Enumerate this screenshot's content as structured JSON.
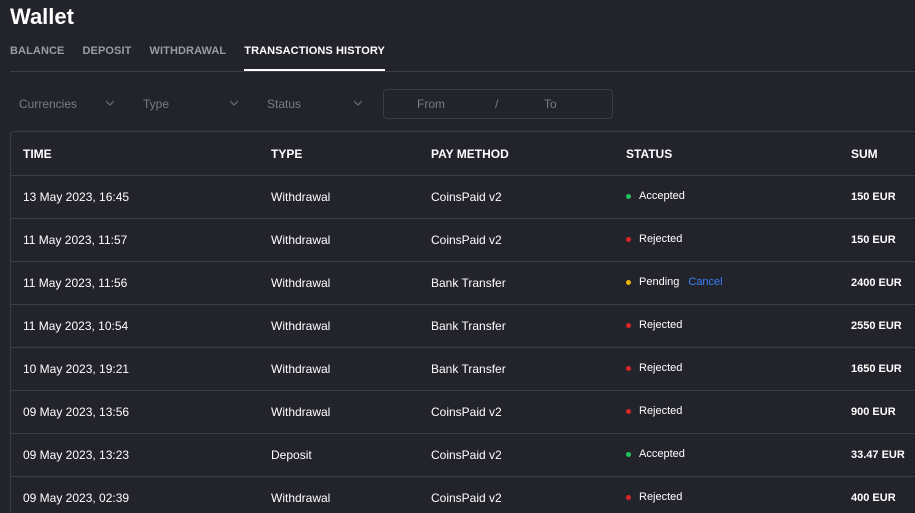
{
  "page": {
    "title": "Wallet"
  },
  "tabs": [
    {
      "label": "BALANCE"
    },
    {
      "label": "DEPOSIT"
    },
    {
      "label": "WITHDRAWAL"
    },
    {
      "label": "TRANSACTIONS HISTORY"
    }
  ],
  "active_tab": "TRANSACTIONS HISTORY",
  "filters": {
    "currencies_placeholder": "Currencies",
    "type_placeholder": "Type",
    "status_placeholder": "Status",
    "date_from_placeholder": "From",
    "date_separator": "/",
    "date_to_placeholder": "To",
    "chevron_icon": "chevron-down-icon"
  },
  "table": {
    "columns": [
      "TIME",
      "TYPE",
      "PAY METHOD",
      "STATUS",
      "SUM"
    ],
    "rows": [
      {
        "time": "13 May 2023, 16:45",
        "type": "Withdrawal",
        "method": "CoinsPaid v2",
        "status": "Accepted",
        "status_color": "#22c55e",
        "action": "",
        "sum": "150 EUR"
      },
      {
        "time": "11 May 2023, 11:57",
        "type": "Withdrawal",
        "method": "CoinsPaid v2",
        "status": "Rejected",
        "status_color": "#dc2626",
        "action": "",
        "sum": "150 EUR"
      },
      {
        "time": "11 May 2023, 11:56",
        "type": "Withdrawal",
        "method": "Bank Transfer",
        "status": "Pending",
        "status_color": "#eab308",
        "action": "Cancel",
        "sum": "2400 EUR"
      },
      {
        "time": "11 May 2023, 10:54",
        "type": "Withdrawal",
        "method": "Bank Transfer",
        "status": "Rejected",
        "status_color": "#dc2626",
        "action": "",
        "sum": "2550 EUR"
      },
      {
        "time": "10 May 2023, 19:21",
        "type": "Withdrawal",
        "method": "Bank Transfer",
        "status": "Rejected",
        "status_color": "#dc2626",
        "action": "",
        "sum": "1650 EUR"
      },
      {
        "time": "09 May 2023, 13:56",
        "type": "Withdrawal",
        "method": "CoinsPaid v2",
        "status": "Rejected",
        "status_color": "#dc2626",
        "action": "",
        "sum": "900 EUR"
      },
      {
        "time": "09 May 2023, 13:23",
        "type": "Deposit",
        "method": "CoinsPaid v2",
        "status": "Accepted",
        "status_color": "#22c55e",
        "action": "",
        "sum": "33.47 EUR"
      },
      {
        "time": "09 May 2023, 02:39",
        "type": "Withdrawal",
        "method": "CoinsPaid v2",
        "status": "Rejected",
        "status_color": "#dc2626",
        "action": "",
        "sum": "400 EUR"
      }
    ]
  },
  "colors": {
    "background": "#22232b",
    "border": "#3b3c46",
    "link": "#3b82f6",
    "muted_text": "#7a7b86"
  }
}
